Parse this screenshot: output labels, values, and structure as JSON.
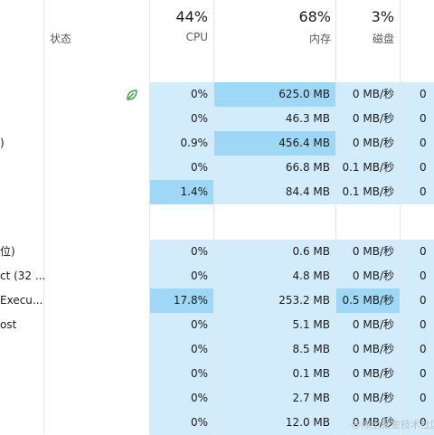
{
  "header": {
    "status_label": "状态",
    "cpu": {
      "percent": "44%",
      "label": "CPU"
    },
    "memory": {
      "percent": "68%",
      "label": "内存"
    },
    "disk": {
      "percent": "3%",
      "label": "磁盘"
    }
  },
  "rows": [
    {
      "name": "",
      "cpu": "0%",
      "memory": "625.0 MB",
      "disk": "0 MB/秒",
      "net": "0",
      "eco": true,
      "hi_memory": true,
      "hi_cpu": false,
      "hi_disk": false
    },
    {
      "name": "",
      "cpu": "0%",
      "memory": "46.3 MB",
      "disk": "0 MB/秒",
      "net": "0",
      "eco": false,
      "hi_memory": false,
      "hi_cpu": false,
      "hi_disk": false
    },
    {
      "name": ")",
      "cpu": "0.9%",
      "memory": "456.4 MB",
      "disk": "0 MB/秒",
      "net": "0",
      "eco": false,
      "hi_memory": true,
      "hi_cpu": false,
      "hi_disk": false
    },
    {
      "name": "",
      "cpu": "0%",
      "memory": "66.8 MB",
      "disk": "0.1 MB/秒",
      "net": "0",
      "eco": false,
      "hi_memory": false,
      "hi_cpu": false,
      "hi_disk": false
    },
    {
      "name": "",
      "cpu": "1.4%",
      "memory": "84.4 MB",
      "disk": "0.1 MB/秒",
      "net": "0",
      "eco": false,
      "hi_memory": false,
      "hi_cpu": true,
      "hi_disk": false
    },
    {
      "name": "位)",
      "cpu": "0%",
      "memory": "0.6 MB",
      "disk": "0 MB/秒",
      "net": "0",
      "eco": false,
      "hi_memory": false,
      "hi_cpu": false,
      "hi_disk": false
    },
    {
      "name": "ct (32 ...",
      "cpu": "0%",
      "memory": "4.8 MB",
      "disk": "0 MB/秒",
      "net": "0",
      "eco": false,
      "hi_memory": false,
      "hi_cpu": false,
      "hi_disk": false
    },
    {
      "name": "Execu...",
      "cpu": "17.8%",
      "memory": "253.2 MB",
      "disk": "0.5 MB/秒",
      "net": "0",
      "eco": false,
      "hi_memory": false,
      "hi_cpu": true,
      "hi_disk": true
    },
    {
      "name": "ost",
      "cpu": "0%",
      "memory": "5.1 MB",
      "disk": "0 MB/秒",
      "net": "0",
      "eco": false,
      "hi_memory": false,
      "hi_cpu": false,
      "hi_disk": false
    },
    {
      "name": "",
      "cpu": "0%",
      "memory": "8.5 MB",
      "disk": "0 MB/秒",
      "net": "0",
      "eco": false,
      "hi_memory": false,
      "hi_cpu": false,
      "hi_disk": false
    },
    {
      "name": "",
      "cpu": "0%",
      "memory": "0.1 MB",
      "disk": "0 MB/秒",
      "net": "0",
      "eco": false,
      "hi_memory": false,
      "hi_cpu": false,
      "hi_disk": false
    },
    {
      "name": "",
      "cpu": "0%",
      "memory": "2.7 MB",
      "disk": "0 MB/秒",
      "net": "0",
      "eco": false,
      "hi_memory": false,
      "hi_cpu": false,
      "hi_disk": false
    },
    {
      "name": "",
      "cpu": "0%",
      "memory": "12.0 MB",
      "disk": "0 MB/秒",
      "net": "0",
      "eco": false,
      "hi_memory": false,
      "hi_cpu": false,
      "hi_disk": false
    }
  ],
  "watermark": "@稀土掘金技术社区",
  "icons": {
    "eco": "leaf-icon"
  },
  "colors": {
    "cell": "#d3ecfb",
    "highlight": "#9fd8f6",
    "eco": "#3a9d3a"
  }
}
